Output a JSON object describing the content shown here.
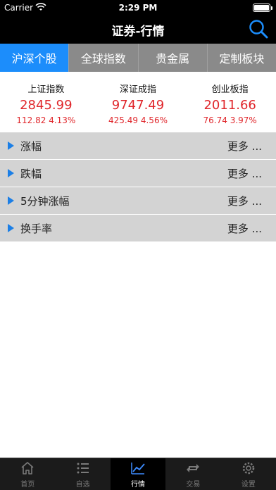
{
  "status": {
    "carrier": "Carrier",
    "time": "2:29 PM"
  },
  "nav": {
    "title": "证券-行情"
  },
  "tabs": [
    "沪深个股",
    "全球指数",
    "贵金属",
    "定制板块"
  ],
  "indices": [
    {
      "name": "上证指数",
      "value": "2845.99",
      "change": "112.82",
      "percent": "4.13%"
    },
    {
      "name": "深证成指",
      "value": "9747.49",
      "change": "425.49",
      "percent": "4.56%"
    },
    {
      "name": "创业板指",
      "value": "2011.66",
      "change": "76.74",
      "percent": "3.97%"
    }
  ],
  "rows": [
    {
      "label": "涨幅",
      "more": "更多 ..."
    },
    {
      "label": "跌幅",
      "more": "更多 ..."
    },
    {
      "label": "5分钟涨幅",
      "more": "更多 ..."
    },
    {
      "label": "换手率",
      "more": "更多 ..."
    }
  ],
  "tabbar": [
    {
      "label": "首页",
      "icon": "home-icon"
    },
    {
      "label": "自选",
      "icon": "list-icon"
    },
    {
      "label": "行情",
      "icon": "chart-icon"
    },
    {
      "label": "交易",
      "icon": "refresh-icon"
    },
    {
      "label": "设置",
      "icon": "gear-icon"
    }
  ],
  "colors": {
    "accent": "#1c8dfb",
    "up": "#e0262b",
    "tabBg": "#8a8a8a",
    "rowBg": "#d3d3d3"
  }
}
